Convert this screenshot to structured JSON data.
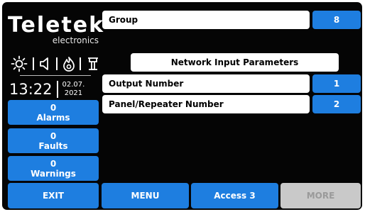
{
  "logo": {
    "brand": "Teletek",
    "subtitle": "electronics"
  },
  "status_bar": {
    "icons": [
      "sun-icon",
      "speaker-icon",
      "flame-icon",
      "fire-detector-icon"
    ]
  },
  "clock": {
    "time": "13:22",
    "date_line1": "02.07.",
    "date_line2": "2021"
  },
  "side_counters": [
    {
      "count": "0",
      "label": "Alarms"
    },
    {
      "count": "0",
      "label": "Faults"
    },
    {
      "count": "0",
      "label": "Warnings"
    }
  ],
  "parameters": {
    "group_label": "Group",
    "group_value": "8",
    "section_title": "Network Input Parameters",
    "output_number_label": "Output Number",
    "output_number_value": "1",
    "panel_repeater_label": "Panel/Repeater Number",
    "panel_repeater_value": "2"
  },
  "bottom_bar": {
    "exit": "EXIT",
    "menu": "MENU",
    "access": "Access 3",
    "more": "MORE"
  },
  "colors": {
    "accent": "#1e7ee0",
    "background": "#050505",
    "disabled": "#c9c9c9"
  }
}
